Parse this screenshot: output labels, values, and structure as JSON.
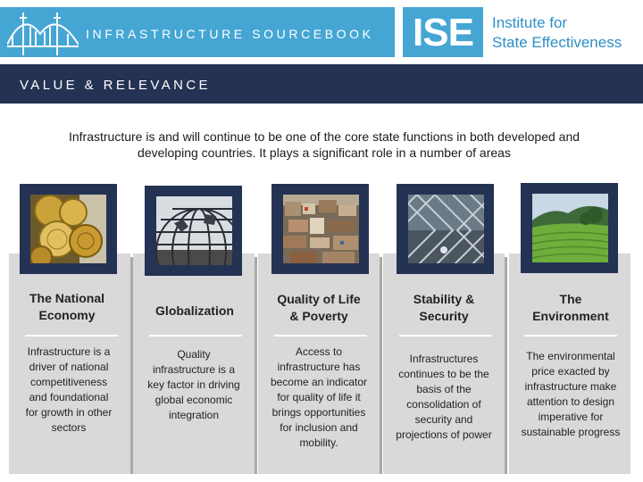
{
  "header": {
    "title": "INFRASTRUCTURE SOURCEBOOK",
    "logo_text": "ISE",
    "institute_line1": "Institute for",
    "institute_line2": "State Effectiveness"
  },
  "section": {
    "title": "VALUE & RELEVANCE"
  },
  "intro": {
    "line1": "Infrastructure is and will continue to be one of the core state functions in both developed and",
    "line2": "developing countries. It plays a significant role in a number of areas"
  },
  "colors": {
    "header_blue": "#45a6d4",
    "navy": "#243253",
    "card_gray": "#d9d9d9",
    "institute_text": "#2d8fc6"
  },
  "columns": [
    {
      "title": [
        "The National",
        "Economy"
      ],
      "image": "gold-coins-photo",
      "desc": [
        "Infrastructure is a",
        "driver of national",
        "competitiveness",
        "and foundational",
        "for growth in other",
        "sectors"
      ]
    },
    {
      "title": [
        "Globalization"
      ],
      "image": "globe-sculpture-photo",
      "desc": [
        "Quality",
        "infrastructure is a",
        "key factor in driving",
        "global economic",
        "integration"
      ]
    },
    {
      "title": [
        "Quality of Life",
        "& Poverty"
      ],
      "image": "slum-housing-photo",
      "desc": [
        "Access to",
        "infrastructure has",
        "become an indicator",
        "for quality of life it",
        "brings opportunities",
        "for inclusion and",
        "mobility."
      ]
    },
    {
      "title": [
        "Stability &",
        "Security"
      ],
      "image": "chain-link-fence-photo",
      "desc": [
        "Infrastructures",
        "continues to be the",
        "basis of the",
        "consolidation of",
        "security and",
        "projections of power"
      ]
    },
    {
      "title": [
        "The",
        "Environment"
      ],
      "image": "tea-plantation-hills-photo",
      "desc": [
        "The environmental",
        "price exacted by",
        "infrastructure make",
        "attention to design",
        "imperative for",
        "sustainable progress"
      ]
    }
  ]
}
